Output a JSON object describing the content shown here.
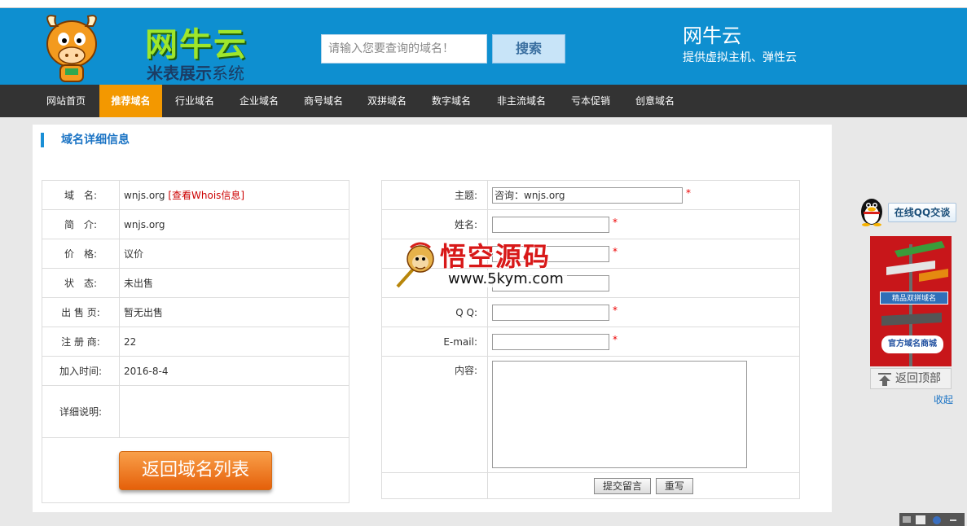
{
  "header": {
    "logo_title": "网牛云",
    "logo_sub_bold": "米表展示",
    "logo_sub_thin": "系统",
    "search_placeholder": "请输入您要查询的域名！",
    "search_button": "搜索",
    "brand_name": "网牛云",
    "brand_slogan": "提供虚拟主机、弹性云"
  },
  "nav": {
    "items": [
      "网站首页",
      "推荐域名",
      "行业域名",
      "企业域名",
      "商号域名",
      "双拼域名",
      "数字域名",
      "非主流域名",
      "亏本促销",
      "创意域名"
    ],
    "active_index": 1
  },
  "section": {
    "title": "域名详细信息"
  },
  "details": {
    "rows": [
      {
        "label": "域　名:",
        "value": "wnjs.org",
        "link": "[查看Whois信息]"
      },
      {
        "label": "简　介:",
        "value": "wnjs.org"
      },
      {
        "label": "价　格:",
        "value": "议价"
      },
      {
        "label": "状　态:",
        "value": "未出售"
      },
      {
        "label": "出 售 页:",
        "value": "暂无出售"
      },
      {
        "label": "注 册 商:",
        "value": "22"
      },
      {
        "label": "加入时间:",
        "value": "2016-8-4"
      },
      {
        "label": "详细说明:",
        "value": ""
      }
    ],
    "back_button": "返回域名列表"
  },
  "form": {
    "subject_label": "主题:",
    "subject_value": "咨询：wnjs.org",
    "name_label": "姓名:",
    "qq_label": "Q Q:",
    "email_label": "E-mail:",
    "content_label": "内容:",
    "required_mark": "*",
    "submit_button": "提交留言",
    "reset_button": "重写"
  },
  "watermark": {
    "title": "悟空源码",
    "url": "www.5kym.com"
  },
  "sidebar": {
    "qq_chat": "在线QQ交谈",
    "ad_label_1": "精品双拼域名",
    "ad_label_2": "官方域名商城",
    "back_to_top": "返回顶部",
    "collapse": "收起"
  },
  "colors": {
    "header_bg": "#0e8fd0",
    "nav_bg": "#333333",
    "nav_active": "#f39800",
    "required": "#ee0000",
    "back_button": "#f07a1e"
  }
}
